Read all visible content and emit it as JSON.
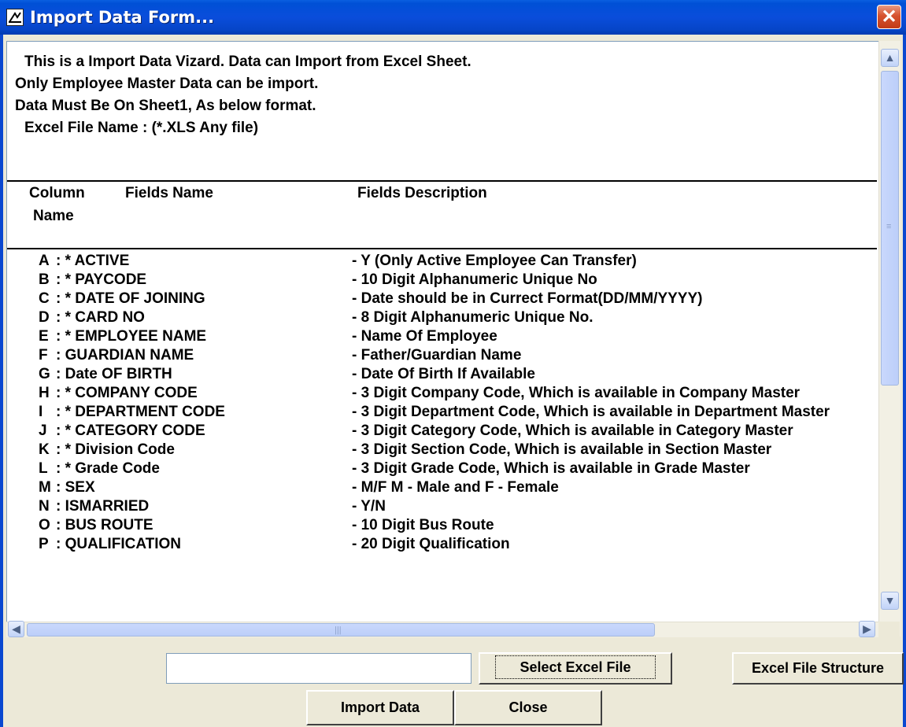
{
  "window": {
    "title": "Import Data Form...",
    "close_label": "✕"
  },
  "intro": {
    "line1": "This is a Import Data Vizard. Data can Import from Excel Sheet.",
    "line2": "Only Employee Master Data can be import.",
    "line3": "Data Must Be On Sheet1, As below format.",
    "line4": "Excel File Name : (*.XLS Any file)"
  },
  "table_headers": {
    "column": "Column",
    "name": "Name",
    "fields_name": "Fields Name",
    "fields_description": "Fields Description"
  },
  "rows": [
    {
      "col": "A",
      "name": ": * ACTIVE",
      "desc": "- Y  (Only Active Employee Can Transfer)"
    },
    {
      "col": "B",
      "name": ": * PAYCODE",
      "desc": "- 10 Digit Alphanumeric Unique No"
    },
    {
      "col": "C",
      "name": ": * DATE OF JOINING",
      "desc": "- Date should be in Currect Format(DD/MM/YYYY)"
    },
    {
      "col": "D",
      "name": ": * CARD NO",
      "desc": "- 8 Digit Alphanumeric Unique No."
    },
    {
      "col": "E",
      "name": ": * EMPLOYEE NAME",
      "desc": "- Name Of Employee"
    },
    {
      "col": "F",
      "name": ":  GUARDIAN NAME",
      "desc": "- Father/Guardian Name"
    },
    {
      "col": "G",
      "name": ":  Date OF BIRTH",
      "desc": "- Date Of Birth If Available"
    },
    {
      "col": "H",
      "name": ": * COMPANY CODE",
      "desc": "- 3 Digit Company Code, Which is available in Company Master"
    },
    {
      "col": "I",
      "name": ": * DEPARTMENT CODE",
      "desc": "- 3 Digit Department Code, Which is available in Department Master"
    },
    {
      "col": "J",
      "name": ": * CATEGORY CODE",
      "desc": "- 3 Digit Category Code, Which is available in Category Master"
    },
    {
      "col": "K",
      "name": ": * Division Code",
      "desc": "- 3 Digit Section Code, Which is available in Section Master"
    },
    {
      "col": "L",
      "name": ": * Grade Code",
      "desc": "- 3 Digit Grade Code, Which is available in Grade Master"
    },
    {
      "col": "M",
      "name": ":  SEX",
      "desc": "- M/F   M - Male and F - Female"
    },
    {
      "col": "N",
      "name": ":  ISMARRIED",
      "desc": "- Y/N"
    },
    {
      "col": "O",
      "name": ":  BUS ROUTE",
      "desc": "- 10 Digit Bus Route"
    },
    {
      "col": "P",
      "name": ":  QUALIFICATION",
      "desc": "- 20 Digit Qualification"
    }
  ],
  "scroll_icons": {
    "up": "scroll-up-arrow",
    "down": "scroll-down-arrow",
    "left": "scroll-left-arrow",
    "right": "scroll-right-arrow"
  },
  "file_input": {
    "value": "",
    "placeholder": ""
  },
  "buttons": {
    "select_excel": "Select Excel File",
    "structure": "Excel File Structure",
    "import": "Import Data",
    "close": "Close"
  }
}
